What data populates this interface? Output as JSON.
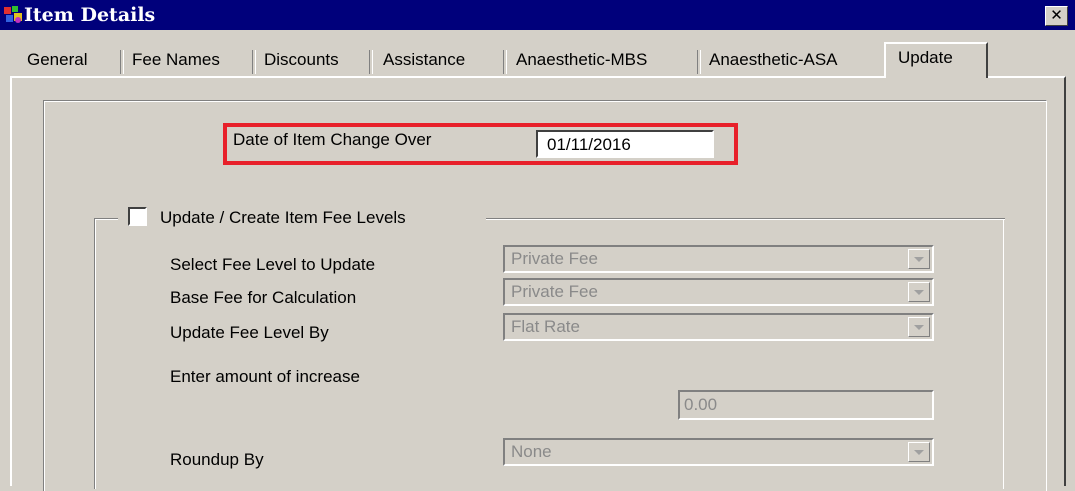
{
  "window": {
    "title": "Item Details",
    "close_label": "✕",
    "icon": "app-icon"
  },
  "tabs": [
    {
      "label": "General"
    },
    {
      "label": "Fee Names"
    },
    {
      "label": "Discounts"
    },
    {
      "label": "Assistance"
    },
    {
      "label": "Anaesthetic-MBS"
    },
    {
      "label": "Anaesthetic-ASA"
    },
    {
      "label": "Update"
    }
  ],
  "active_tab": "Update",
  "update": {
    "date_label": "Date of Item Change Over",
    "date_value": "01/11/2016",
    "highlight_color": "#e8202a",
    "group_label": "Update / Create Item Fee Levels",
    "group_checked": false,
    "select_fee_level_label": "Select Fee Level to Update",
    "select_fee_level_value": "Private Fee",
    "base_fee_label": "Base Fee for Calculation",
    "base_fee_value": "Private Fee",
    "update_by_label": "Update Fee Level By",
    "update_by_value": "Flat Rate",
    "increase_label": "Enter amount of increase",
    "increase_value": "0.00",
    "roundup_label": "Roundup By",
    "roundup_value": "None"
  }
}
